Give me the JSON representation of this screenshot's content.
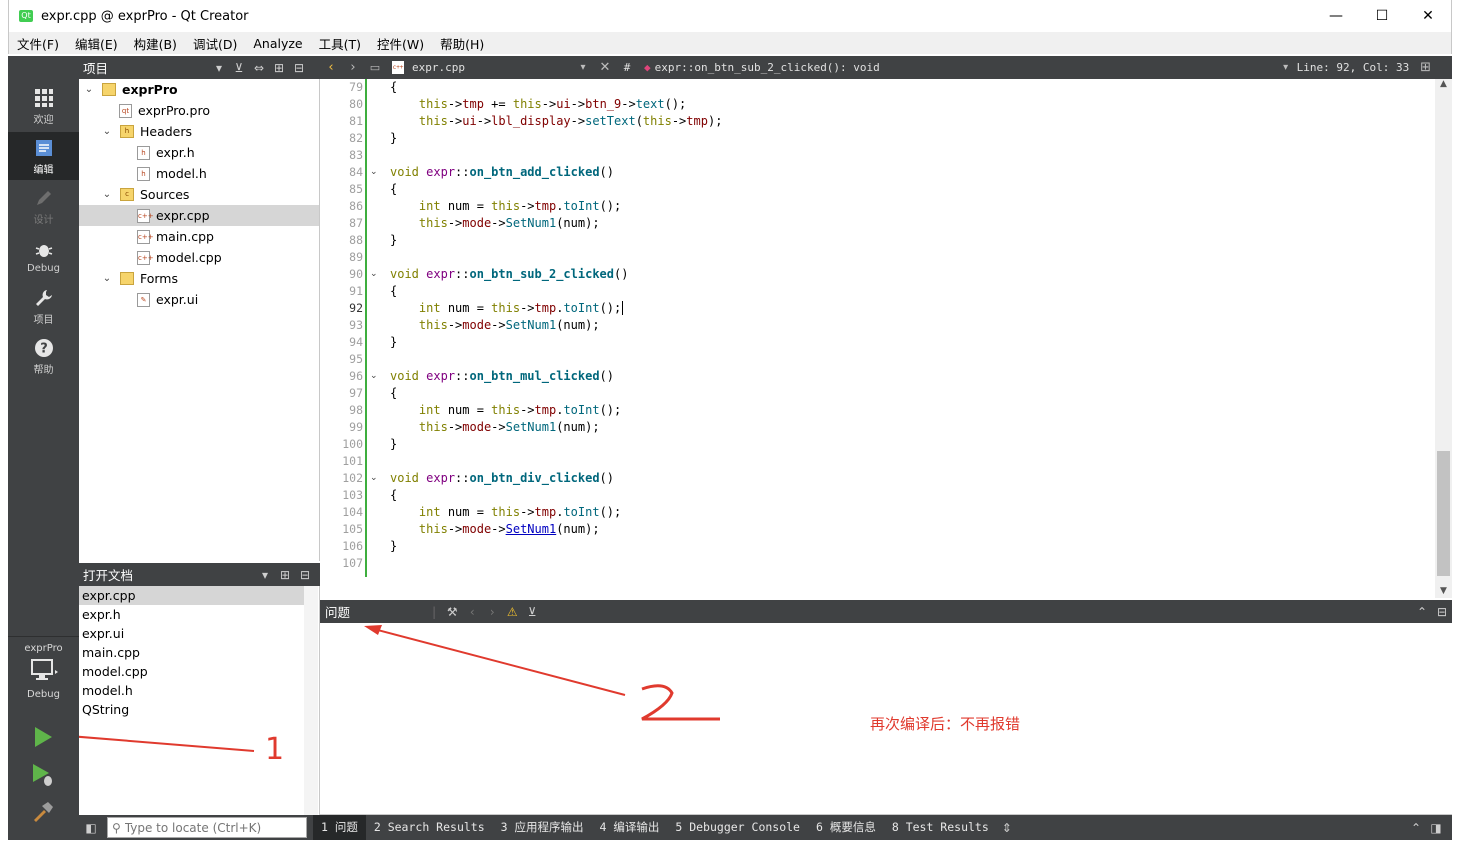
{
  "window": {
    "title": "expr.cpp @ exprPro - Qt Creator",
    "app_icon_label": "Qt",
    "controls": {
      "minimize": "—",
      "maximize": "☐",
      "close": "✕"
    }
  },
  "menu": [
    "文件(F)",
    "编辑(E)",
    "构建(B)",
    "调试(D)",
    "Analyze",
    "工具(T)",
    "控件(W)",
    "帮助(H)"
  ],
  "modes": [
    {
      "label": "欢迎",
      "icon": "grid-icon"
    },
    {
      "label": "编辑",
      "icon": "edit-icon"
    },
    {
      "label": "设计",
      "icon": "pen-icon"
    },
    {
      "label": "Debug",
      "icon": "bug-icon"
    },
    {
      "label": "项目",
      "icon": "wrench-icon"
    },
    {
      "label": "帮助",
      "icon": "help-icon"
    }
  ],
  "kit": {
    "project": "exprPro",
    "config": "Debug"
  },
  "project_panel": {
    "title": "项目",
    "tree": [
      {
        "label": "exprPro",
        "level": 0,
        "expanded": true,
        "kind": "project"
      },
      {
        "label": "exprPro.pro",
        "level": 1,
        "kind": "pro"
      },
      {
        "label": "Headers",
        "level": 1,
        "expanded": true,
        "kind": "folder"
      },
      {
        "label": "expr.h",
        "level": 2,
        "kind": "h"
      },
      {
        "label": "model.h",
        "level": 2,
        "kind": "h"
      },
      {
        "label": "Sources",
        "level": 1,
        "expanded": true,
        "kind": "folder"
      },
      {
        "label": "expr.cpp",
        "level": 2,
        "kind": "cpp",
        "selected": true
      },
      {
        "label": "main.cpp",
        "level": 2,
        "kind": "cpp"
      },
      {
        "label": "model.cpp",
        "level": 2,
        "kind": "cpp"
      },
      {
        "label": "Forms",
        "level": 1,
        "expanded": true,
        "kind": "folder"
      },
      {
        "label": "expr.ui",
        "level": 2,
        "kind": "ui"
      }
    ]
  },
  "open_documents": {
    "title": "打开文档",
    "items": [
      "expr.cpp",
      "expr.h",
      "expr.ui",
      "main.cpp",
      "model.cpp",
      "model.h",
      "QString"
    ],
    "selected": "expr.cpp"
  },
  "editor_toolbar": {
    "file": "expr.cpp",
    "hash": "#",
    "symbol": "expr::on_btn_sub_2_clicked(): void",
    "position": "Line: 92, Col: 33"
  },
  "editor": {
    "current_line": 92,
    "lines": [
      {
        "n": 79,
        "text": "{"
      },
      {
        "n": 80,
        "text": "    this->tmp += this->ui->btn_9->text();"
      },
      {
        "n": 81,
        "text": "    this->ui->lbl_display->setText(this->tmp);"
      },
      {
        "n": 82,
        "text": "}"
      },
      {
        "n": 83,
        "text": ""
      },
      {
        "n": 84,
        "text": "void expr::on_btn_add_clicked()",
        "fold": true
      },
      {
        "n": 85,
        "text": "{"
      },
      {
        "n": 86,
        "text": "    int num = this->tmp.toInt();"
      },
      {
        "n": 87,
        "text": "    this->mode->SetNum1(num);"
      },
      {
        "n": 88,
        "text": "}"
      },
      {
        "n": 89,
        "text": ""
      },
      {
        "n": 90,
        "text": "void expr::on_btn_sub_2_clicked()",
        "fold": true
      },
      {
        "n": 91,
        "text": "{"
      },
      {
        "n": 92,
        "text": "    int num = this->tmp.toInt();"
      },
      {
        "n": 93,
        "text": "    this->mode->SetNum1(num);"
      },
      {
        "n": 94,
        "text": "}"
      },
      {
        "n": 95,
        "text": ""
      },
      {
        "n": 96,
        "text": "void expr::on_btn_mul_clicked()",
        "fold": true
      },
      {
        "n": 97,
        "text": "{"
      },
      {
        "n": 98,
        "text": "    int num = this->tmp.toInt();"
      },
      {
        "n": 99,
        "text": "    this->mode->SetNum1(num);"
      },
      {
        "n": 100,
        "text": "}"
      },
      {
        "n": 101,
        "text": ""
      },
      {
        "n": 102,
        "text": "void expr::on_btn_div_clicked()",
        "fold": true
      },
      {
        "n": 103,
        "text": "{"
      },
      {
        "n": 104,
        "text": "    int num = this->tmp.toInt();"
      },
      {
        "n": 105,
        "text": "    this->mode->SetNum1(num);"
      },
      {
        "n": 106,
        "text": "}"
      },
      {
        "n": 107,
        "text": ""
      }
    ]
  },
  "issues": {
    "title": "问题",
    "annotation": "再次编译后：不再报错",
    "marker_1": "1",
    "marker_2": "2"
  },
  "status": {
    "locator_placeholder": "Type to locate (Ctrl+K)",
    "tabs": [
      "1 问题",
      "2 Search Results",
      "3 应用程序输出",
      "4 编译输出",
      "5 Debugger Console",
      "6 概要信息",
      "8 Test Results"
    ]
  },
  "colors": {
    "accent_green": "#41cd52",
    "annotation_red": "#e03a2e",
    "keyword": "#808000",
    "function": "#00677c",
    "member": "#800000"
  }
}
